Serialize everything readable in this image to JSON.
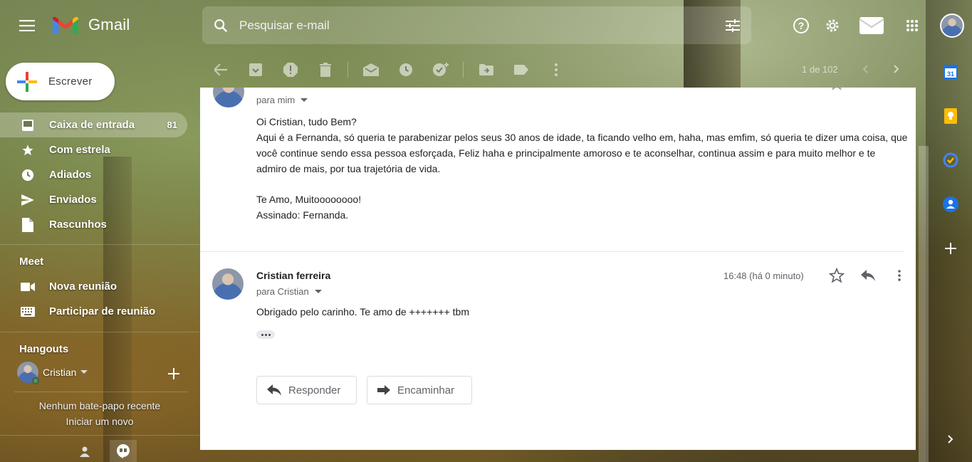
{
  "app": {
    "name": "Gmail"
  },
  "search": {
    "placeholder": "Pesquisar e-mail"
  },
  "compose": {
    "label": "Escrever"
  },
  "nav": [
    {
      "label": "Caixa de entrada",
      "count": "81",
      "icon": "inbox-icon",
      "active": true
    },
    {
      "label": "Com estrela",
      "count": "",
      "icon": "star-icon"
    },
    {
      "label": "Adiados",
      "count": "",
      "icon": "clock-icon"
    },
    {
      "label": "Enviados",
      "count": "",
      "icon": "send-icon"
    },
    {
      "label": "Rascunhos",
      "count": "",
      "icon": "draft-icon"
    }
  ],
  "meet": {
    "title": "Meet",
    "items": [
      {
        "label": "Nova reunião",
        "icon": "video-icon"
      },
      {
        "label": "Participar de reunião",
        "icon": "keyboard-icon"
      }
    ]
  },
  "hangouts": {
    "title": "Hangouts",
    "user": "Cristian",
    "no_chat": "Nenhum bate-papo recente",
    "start_new": "Iniciar um novo"
  },
  "toolbar": {
    "pager": "1 de 102"
  },
  "message1": {
    "to": "para mim",
    "body": [
      "Oi Cristian, tudo Bem?",
      "Aqui é a Fernanda, só queria te parabenizar pelos seus 30 anos de idade, ta ficando velho em, haha, mas emfim, só queria te dizer uma coisa, que você continue sendo essa pessoa esforçada, Feliz haha e principalmente amoroso e te aconselhar, continua assim e para muito melhor e te admiro de mais, por tua trajetória de vida.",
      "",
      "Te Amo, Muitoooooooo!",
      "Assinado: Fernanda."
    ]
  },
  "message2": {
    "sender": "Cristian ferreira",
    "to": "para Cristian",
    "time": "16:48 (há 0 minuto)",
    "body": "Obrigado pelo carinho. Te amo de +++++++ tbm"
  },
  "actions": {
    "reply": "Responder",
    "forward": "Encaminhar"
  },
  "colors": {
    "accent_blue": "#1a73e8",
    "gmail_red": "#ea4335"
  }
}
